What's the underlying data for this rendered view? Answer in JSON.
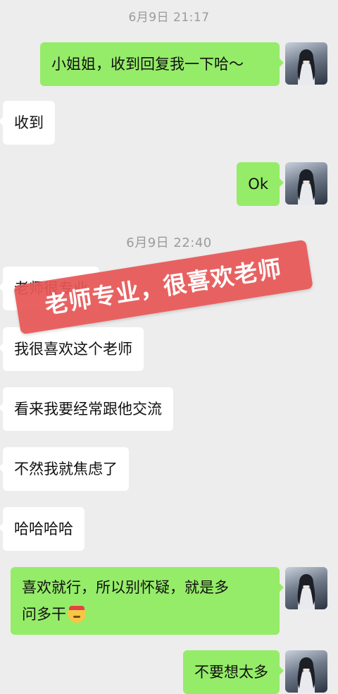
{
  "messages": [
    {
      "type": "time",
      "text": "6月9日 21:17"
    },
    {
      "type": "sent",
      "text": "小姐姐，收到回复我一下哈～"
    },
    {
      "type": "received",
      "text": "收到"
    },
    {
      "type": "sent",
      "text": "Ok"
    },
    {
      "type": "time",
      "text": "6月9日 22:40"
    },
    {
      "type": "received",
      "text": "老师很专业"
    },
    {
      "type": "received",
      "text": "我很喜欢这个老师"
    },
    {
      "type": "received",
      "text": "看来我要经常跟他交流"
    },
    {
      "type": "received",
      "text": "不然我就焦虑了"
    },
    {
      "type": "received",
      "text": "哈哈哈哈"
    },
    {
      "type": "sent",
      "text_line1": "喜欢就行，所以别怀疑，就是多",
      "text_line2": "问多干",
      "emoji": "shushing-face-emoji"
    },
    {
      "type": "sent",
      "text": "不要想太多"
    }
  ],
  "overlay": {
    "text": "老师专业，很喜欢老师",
    "color": "#e75656"
  },
  "colors": {
    "sent_bubble": "#95ec69",
    "received_bubble": "#ffffff",
    "background": "#ededed",
    "timestamp": "#9b9b9b"
  }
}
